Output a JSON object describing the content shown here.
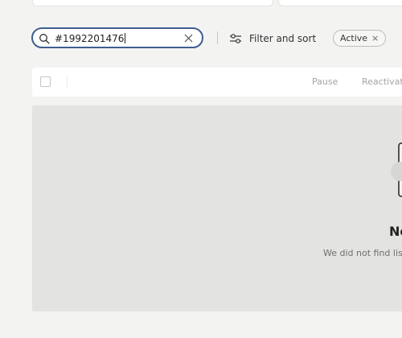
{
  "search": {
    "value": "#1992201476",
    "icon": "search-icon",
    "clear_icon": "close-icon"
  },
  "filter": {
    "label": "Filter and sort",
    "icon": "sliders-icon"
  },
  "active_filter_chip": {
    "label": "Active",
    "remove_glyph": "×"
  },
  "bulk_actions": {
    "pause_label": "Pause",
    "reactivate_label": "Reactivate"
  },
  "empty_state": {
    "title": "No",
    "description": "We did not find listi"
  },
  "colors": {
    "background": "#f3f3f2",
    "search_border": "#3e5f8f",
    "empty_panel": "#e3e3e2",
    "muted_text": "#a3a3a1"
  }
}
